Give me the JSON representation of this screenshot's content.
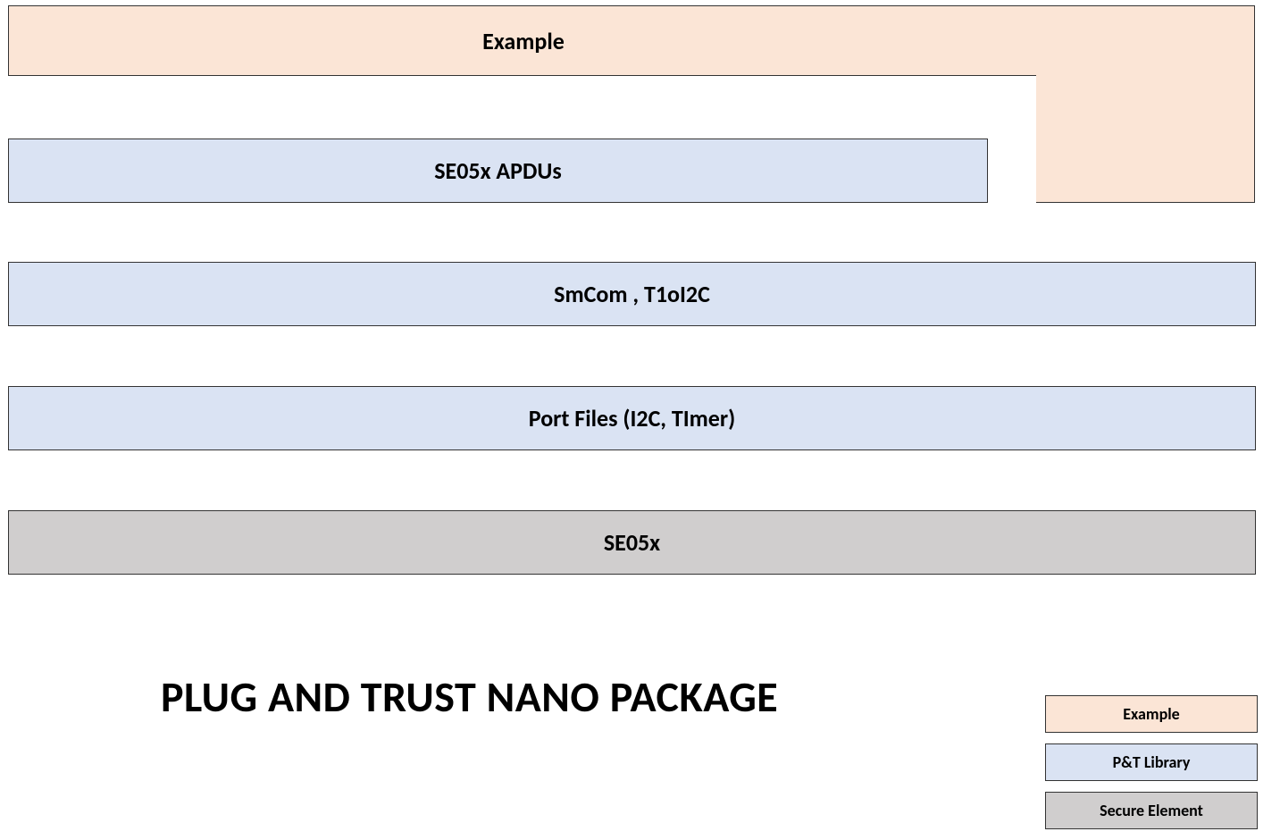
{
  "blocks": {
    "example": "Example",
    "apdus": "SE05x APDUs",
    "smcom": "SmCom , T1oI2C",
    "port": "Port Files (I2C, TImer)",
    "se05x": "SE05x"
  },
  "title": "PLUG AND TRUST NANO PACKAGE",
  "legend": {
    "example": "Example",
    "ptlib": "P&T Library",
    "secure": "Secure Element"
  },
  "chart_data": {
    "type": "diagram",
    "title": "PLUG AND TRUST NANO PACKAGE",
    "layers": [
      {
        "name": "Example",
        "category": "Example",
        "row": 1,
        "width": "full",
        "notes": "L-shape: also spans rows 1–2 on right side"
      },
      {
        "name": "SE05x APDUs",
        "category": "P&T Library",
        "row": 2,
        "width": "partial",
        "notes": "~90% width from left"
      },
      {
        "name": "SmCom , T1oI2C",
        "category": "P&T Library",
        "row": 3,
        "width": "full"
      },
      {
        "name": "Port Files (I2C, TImer)",
        "category": "P&T Library",
        "row": 4,
        "width": "full"
      },
      {
        "name": "SE05x",
        "category": "Secure Element",
        "row": 5,
        "width": "full"
      }
    ],
    "legend": [
      {
        "label": "Example",
        "color": "#fbe5d6"
      },
      {
        "label": "P&T Library",
        "color": "#dae3f3"
      },
      {
        "label": "Secure Element",
        "color": "#d0cece"
      }
    ]
  }
}
